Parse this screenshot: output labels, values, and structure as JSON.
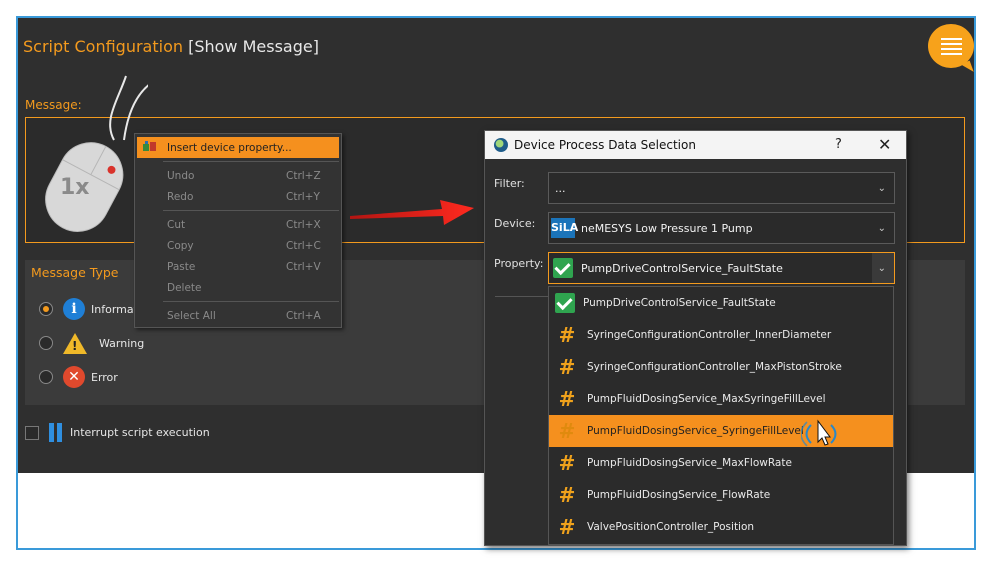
{
  "window": {
    "title": "Script Configuration",
    "subtitle": "[Show Message]"
  },
  "message": {
    "label": "Message:"
  },
  "message_type": {
    "title": "Message Type",
    "options": [
      {
        "label": "Informati",
        "selected": true,
        "icon": "info-icon"
      },
      {
        "label": "Warning",
        "selected": false,
        "icon": "warning-icon"
      },
      {
        "label": "Error",
        "selected": false,
        "icon": "error-icon"
      }
    ]
  },
  "interrupt": {
    "label": "Interrupt script execution",
    "checked": false
  },
  "context_menu": {
    "items": [
      {
        "label": "Insert device property...",
        "shortcut": "",
        "highlighted": true
      },
      {
        "label": "Undo",
        "shortcut": "Ctrl+Z"
      },
      {
        "label": "Redo",
        "shortcut": "Ctrl+Y"
      },
      {
        "label": "Cut",
        "shortcut": "Ctrl+X"
      },
      {
        "label": "Copy",
        "shortcut": "Ctrl+C"
      },
      {
        "label": "Paste",
        "shortcut": "Ctrl+V"
      },
      {
        "label": "Delete",
        "shortcut": ""
      },
      {
        "label": "Select All",
        "shortcut": "Ctrl+A"
      }
    ]
  },
  "mouse_badge": "1x",
  "dialog": {
    "title": "Device Process Data Selection",
    "help": "?",
    "close": "✕",
    "filter_label": "Filter:",
    "filter_value": "...",
    "device_label": "Device:",
    "device_logo": "SiLA",
    "device_value": "neMESYS Low Pressure 1 Pump",
    "property_label": "Property:",
    "property_value": "PumpDriveControlService_FaultState"
  },
  "property_list": [
    {
      "label": "PumpDriveControlService_FaultState",
      "icon": "check-icon",
      "highlighted": false
    },
    {
      "label": "SyringeConfigurationController_InnerDiameter",
      "icon": "hash-icon",
      "highlighted": false
    },
    {
      "label": "SyringeConfigurationController_MaxPistonStroke",
      "icon": "hash-icon",
      "highlighted": false
    },
    {
      "label": "PumpFluidDosingService_MaxSyringeFillLevel",
      "icon": "hash-icon",
      "highlighted": false
    },
    {
      "label": "PumpFluidDosingService_SyringeFillLevel",
      "icon": "hash-icon",
      "highlighted": true
    },
    {
      "label": "PumpFluidDosingService_MaxFlowRate",
      "icon": "hash-icon",
      "highlighted": false
    },
    {
      "label": "PumpFluidDosingService_FlowRate",
      "icon": "hash-icon",
      "highlighted": false
    },
    {
      "label": "ValvePositionController_Position",
      "icon": "hash-icon",
      "highlighted": false
    }
  ],
  "colors": {
    "accent": "#f39a1e",
    "background": "#2f2f2f",
    "frame": "#3a9ad9",
    "arrow": "#e0201a"
  }
}
